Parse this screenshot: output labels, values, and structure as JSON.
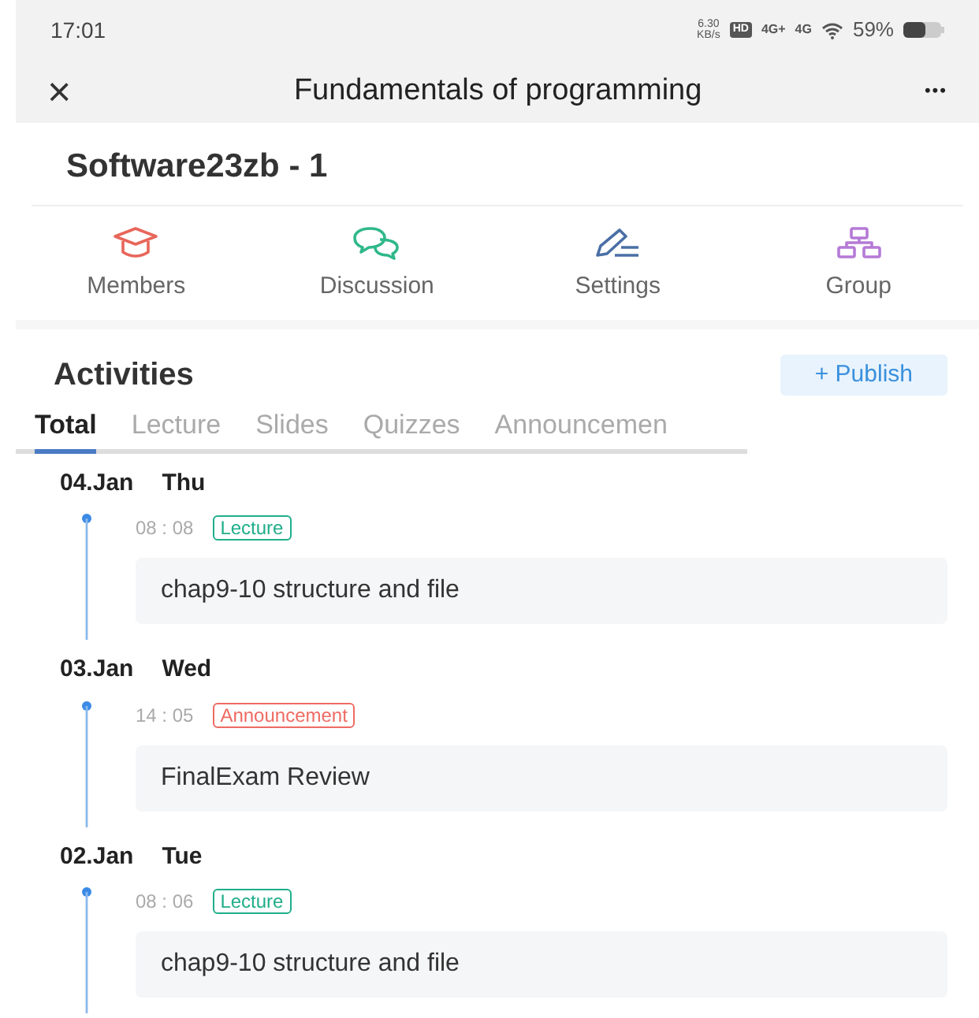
{
  "status_bar": {
    "time": "17:01",
    "net_speed": "6.30",
    "net_unit": "KB/s",
    "hd": "HD",
    "signal_1": "4G+",
    "signal_2": "4G",
    "battery": "59%"
  },
  "header": {
    "close": "×",
    "title": "Fundamentals of programming",
    "more": "•••"
  },
  "class_name": "Software23zb - 1",
  "shortcuts": [
    {
      "kind": "members",
      "label": "Members",
      "color": "#e8665a"
    },
    {
      "kind": "discussion",
      "label": "Discussion",
      "color": "#2fb88a"
    },
    {
      "kind": "settings",
      "label": "Settings",
      "color": "#4a6fa5"
    },
    {
      "kind": "group",
      "label": "Group",
      "color": "#b57ad6"
    }
  ],
  "activities": {
    "title": "Activities",
    "publish": "+ Publish"
  },
  "tabs": [
    {
      "label": "Total",
      "selected": true
    },
    {
      "label": "Lecture",
      "selected": false
    },
    {
      "label": "Slides",
      "selected": false
    },
    {
      "label": "Quizzes",
      "selected": false
    },
    {
      "label": "Announcemen",
      "selected": false
    }
  ],
  "days": [
    {
      "date": "04.Jan",
      "weekday": "Thu",
      "entries": [
        {
          "time": "08 : 08",
          "tag": "Lecture",
          "color": "#1fae8a",
          "title": "chap9-10 structure and file"
        }
      ]
    },
    {
      "date": "03.Jan",
      "weekday": "Wed",
      "entries": [
        {
          "time": "14 : 05",
          "tag": "Announcement",
          "color": "#ee6b63",
          "title": "FinalExam Review"
        }
      ]
    },
    {
      "date": "02.Jan",
      "weekday": "Tue",
      "entries": [
        {
          "time": "08 : 06",
          "tag": "Lecture",
          "color": "#1fae8a",
          "title": "chap9-10 structure and file"
        }
      ]
    }
  ]
}
